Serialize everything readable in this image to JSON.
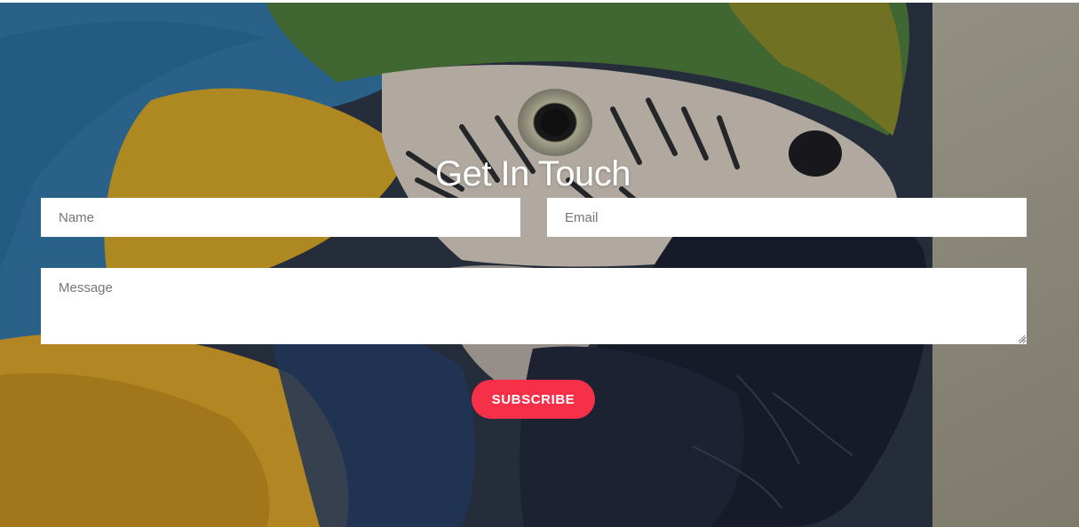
{
  "contact": {
    "title": "Get In Touch",
    "name_placeholder": "Name",
    "email_placeholder": "Email",
    "message_placeholder": "Message",
    "subscribe_label": "SUBSCRIBE"
  },
  "colors": {
    "button_bg": "#f7304a",
    "title_text": "#ffffff",
    "field_bg": "#ffffff"
  }
}
